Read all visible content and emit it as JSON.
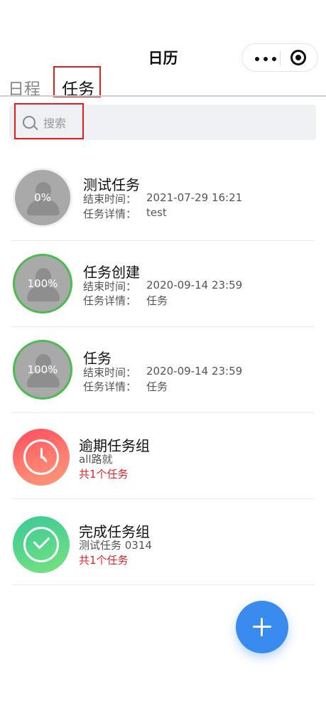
{
  "header": {
    "title": "日历"
  },
  "tabs": [
    {
      "label": "日程",
      "active": false
    },
    {
      "label": "任务",
      "active": true
    }
  ],
  "search": {
    "placeholder": "搜索",
    "value": ""
  },
  "tasks": [
    {
      "title": "测试任务",
      "end_label": "结束时间：",
      "end_time": "2021-07-29 16:21",
      "detail_label": "任务详情：",
      "detail": "test",
      "progress": "0%"
    },
    {
      "title": "任务创建",
      "end_label": "结束时间：",
      "end_time": "2020-09-14 23:59",
      "detail_label": "任务详情：",
      "detail": "任务",
      "progress": "100%"
    },
    {
      "title": "任务",
      "end_label": "结束时间：",
      "end_time": "2020-09-14 23:59",
      "detail_label": "任务详情：",
      "detail": "任务",
      "progress": "100%"
    }
  ],
  "groups": [
    {
      "title": "逾期任务组",
      "sub": "all路就",
      "count": "共1个任务",
      "icon": "clock-icon",
      "color": "#ff5a66"
    },
    {
      "title": "完成任务组",
      "sub": "测试任务 0314",
      "count": "共1个任务",
      "icon": "check-icon",
      "color": "#4fcf8c"
    }
  ],
  "colors": {
    "accent": "#3a8bf0",
    "alert": "#e0252a",
    "progress_done": "#4cbb52"
  },
  "fab": {
    "icon": "plus-icon"
  }
}
